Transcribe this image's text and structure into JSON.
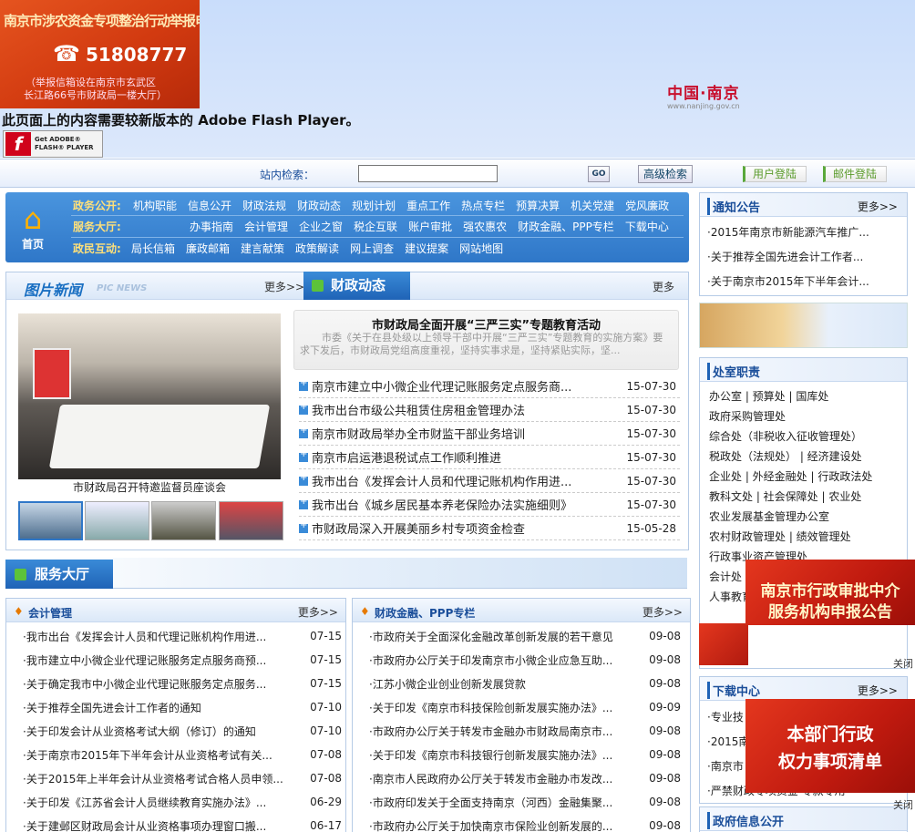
{
  "hotline": {
    "title": "南京市涉农资金专项整治行动举报电话：",
    "number": "51808777",
    "note_line1": "（举报信箱设在南京市玄武区",
    "note_line2": "长江路66号市财政局一楼大厅）"
  },
  "logo": {
    "cn": "中国·南京",
    "en": "www.nanjing.gov.cn"
  },
  "flash": {
    "message": "此页面上的内容需要较新版本的 Adobe Flash Player。",
    "button_line1": "Get ADOBE®",
    "button_line2": "FLASH® PLAYER"
  },
  "search": {
    "label": "站内检索：",
    "value": "",
    "go": "GO",
    "advanced": "高级检索",
    "user_login": "用户登陆",
    "mail_login": "邮件登陆"
  },
  "nav": {
    "home": "首页",
    "rows": [
      {
        "key": "政务公开:",
        "items": [
          "机构职能",
          "信息公开",
          "财政法规",
          "财政动态",
          "规划计划",
          "重点工作",
          "热点专栏",
          "预算决算",
          "机关党建",
          "党风廉政"
        ]
      },
      {
        "key": "服务大厅:",
        "items": [
          "办事指南",
          "会计管理",
          "企业之窗",
          "税企互联",
          "账户审批",
          "强农惠农",
          "财政金融、PPP专栏",
          "下载中心"
        ]
      },
      {
        "key": "政民互动:",
        "items": [
          "局长信箱",
          "廉政邮箱",
          "建言献策",
          "政策解读",
          "网上调查",
          "建议提案",
          "网站地图"
        ]
      }
    ]
  },
  "picnews": {
    "title": "图片新闻",
    "subtitle": "PIC NEWS",
    "more": "更多>>",
    "caption": "市财政局召开特邀监督员座谈会"
  },
  "fiscal": {
    "title": "财政动态",
    "more": "更多",
    "headline": "市财政局全面开展“三严三实”专题教育活动",
    "summary": "市委《关于在县处级以上领导干部中开展“三严三实”专题教育的实施方案》要求下发后，市财政局党组高度重视，坚持实事求是，坚持紧贴实际，坚...",
    "items": [
      {
        "title": "南京市建立中小微企业代理记账服务定点服务商...",
        "date": "15-07-30"
      },
      {
        "title": "我市出台市级公共租赁住房租金管理办法",
        "date": "15-07-30"
      },
      {
        "title": "南京市财政局举办全市财监干部业务培训",
        "date": "15-07-30"
      },
      {
        "title": "南京市启运港退税试点工作顺利推进",
        "date": "15-07-30"
      },
      {
        "title": "我市出台《发挥会计人员和代理记账机构作用进...",
        "date": "15-07-30"
      },
      {
        "title": "我市出台《城乡居民基本养老保险办法实施细则》",
        "date": "15-07-30"
      },
      {
        "title": "市财政局深入开展美丽乡村专项资金检查",
        "date": "15-05-28"
      }
    ]
  },
  "service": {
    "title": "服务大厅"
  },
  "accounting": {
    "title": "会计管理",
    "more": "更多>>",
    "items": [
      {
        "title": "我市出台《发挥会计人员和代理记账机构作用进...",
        "date": "07-15"
      },
      {
        "title": "我市建立中小微企业代理记账服务定点服务商预...",
        "date": "07-15"
      },
      {
        "title": "关于确定我市中小微企业代理记账服务定点服务...",
        "date": "07-15"
      },
      {
        "title": "关于推荐全国先进会计工作者的通知",
        "date": "07-10"
      },
      {
        "title": "关于印发会计从业资格考试大纲（修订）的通知",
        "date": "07-10"
      },
      {
        "title": "关于南京市2015年下半年会计从业资格考试有关...",
        "date": "07-08"
      },
      {
        "title": "关于2015年上半年会计从业资格考试合格人员申领...",
        "date": "07-08"
      },
      {
        "title": "关于印发《江苏省会计人员继续教育实施办法》...",
        "date": "06-29"
      },
      {
        "title": "关于建邺区财政局会计从业资格事项办理窗口搬...",
        "date": "06-17"
      }
    ]
  },
  "finance": {
    "title": "财政金融、PPP专栏",
    "more": "更多>>",
    "items": [
      {
        "title": "市政府关于全面深化金融改革创新发展的若干意见",
        "date": "09-08"
      },
      {
        "title": "市政府办公厅关于印发南京市小微企业应急互助...",
        "date": "09-08"
      },
      {
        "title": "江苏小微企业创业创新发展贷款",
        "date": "09-08"
      },
      {
        "title": "关于印发《南京市科技保险创新发展实施办法》...",
        "date": "09-09"
      },
      {
        "title": "市政府办公厅关于转发市金融办市财政局南京市...",
        "date": "09-08"
      },
      {
        "title": "关于印发《南京市科技银行创新发展实施办法》...",
        "date": "09-08"
      },
      {
        "title": "南京市人民政府办公厅关于转发市金融办市发改...",
        "date": "09-08"
      },
      {
        "title": "市政府印发关于全面支持南京（河西）金融集聚...",
        "date": "09-08"
      },
      {
        "title": "市政府办公厅关于加快南京市保险业创新发展的...",
        "date": "09-08"
      }
    ]
  },
  "notice": {
    "title": "通知公告",
    "more": "更多>>",
    "items": [
      "2015年南京市新能源汽车推广...",
      "关于推荐全国先进会计工作者...",
      "关于南京市2015年下半年会计..."
    ]
  },
  "depts": {
    "title": "处室职责",
    "rows": [
      "办公室 | 预算处 | 国库处",
      "政府采购管理处",
      "综合处（非税收入征收管理处）",
      "税政处（法规处） | 经济建设处",
      "企业处 | 外经金融处 | 行政政法处",
      "教科文处 | 社会保障处 | 农业处",
      "农业发展基金管理办公室",
      "农村财政管理处 | 绩效管理处",
      "行政事业资产管理处",
      "会计处",
      "人事教育处"
    ]
  },
  "ad1": {
    "line1": "南京市行政审批中介",
    "line2": "服务机构申报公告",
    "close": "关闭"
  },
  "download": {
    "title": "下载中心",
    "more": "更多>>",
    "items": [
      "专业技",
      "2015南",
      "南京市",
      "严禁财政专项资金 专款专用"
    ]
  },
  "ad2": {
    "line1": "本部门行政",
    "line2": "权力事项清单",
    "close": "关闭"
  },
  "govinfo": {
    "title": "政府信息公开"
  },
  "colors": {
    "nav_blue": "#2f77c8",
    "accent_red": "#c8102e",
    "link_blue": "#1a4e9a"
  }
}
